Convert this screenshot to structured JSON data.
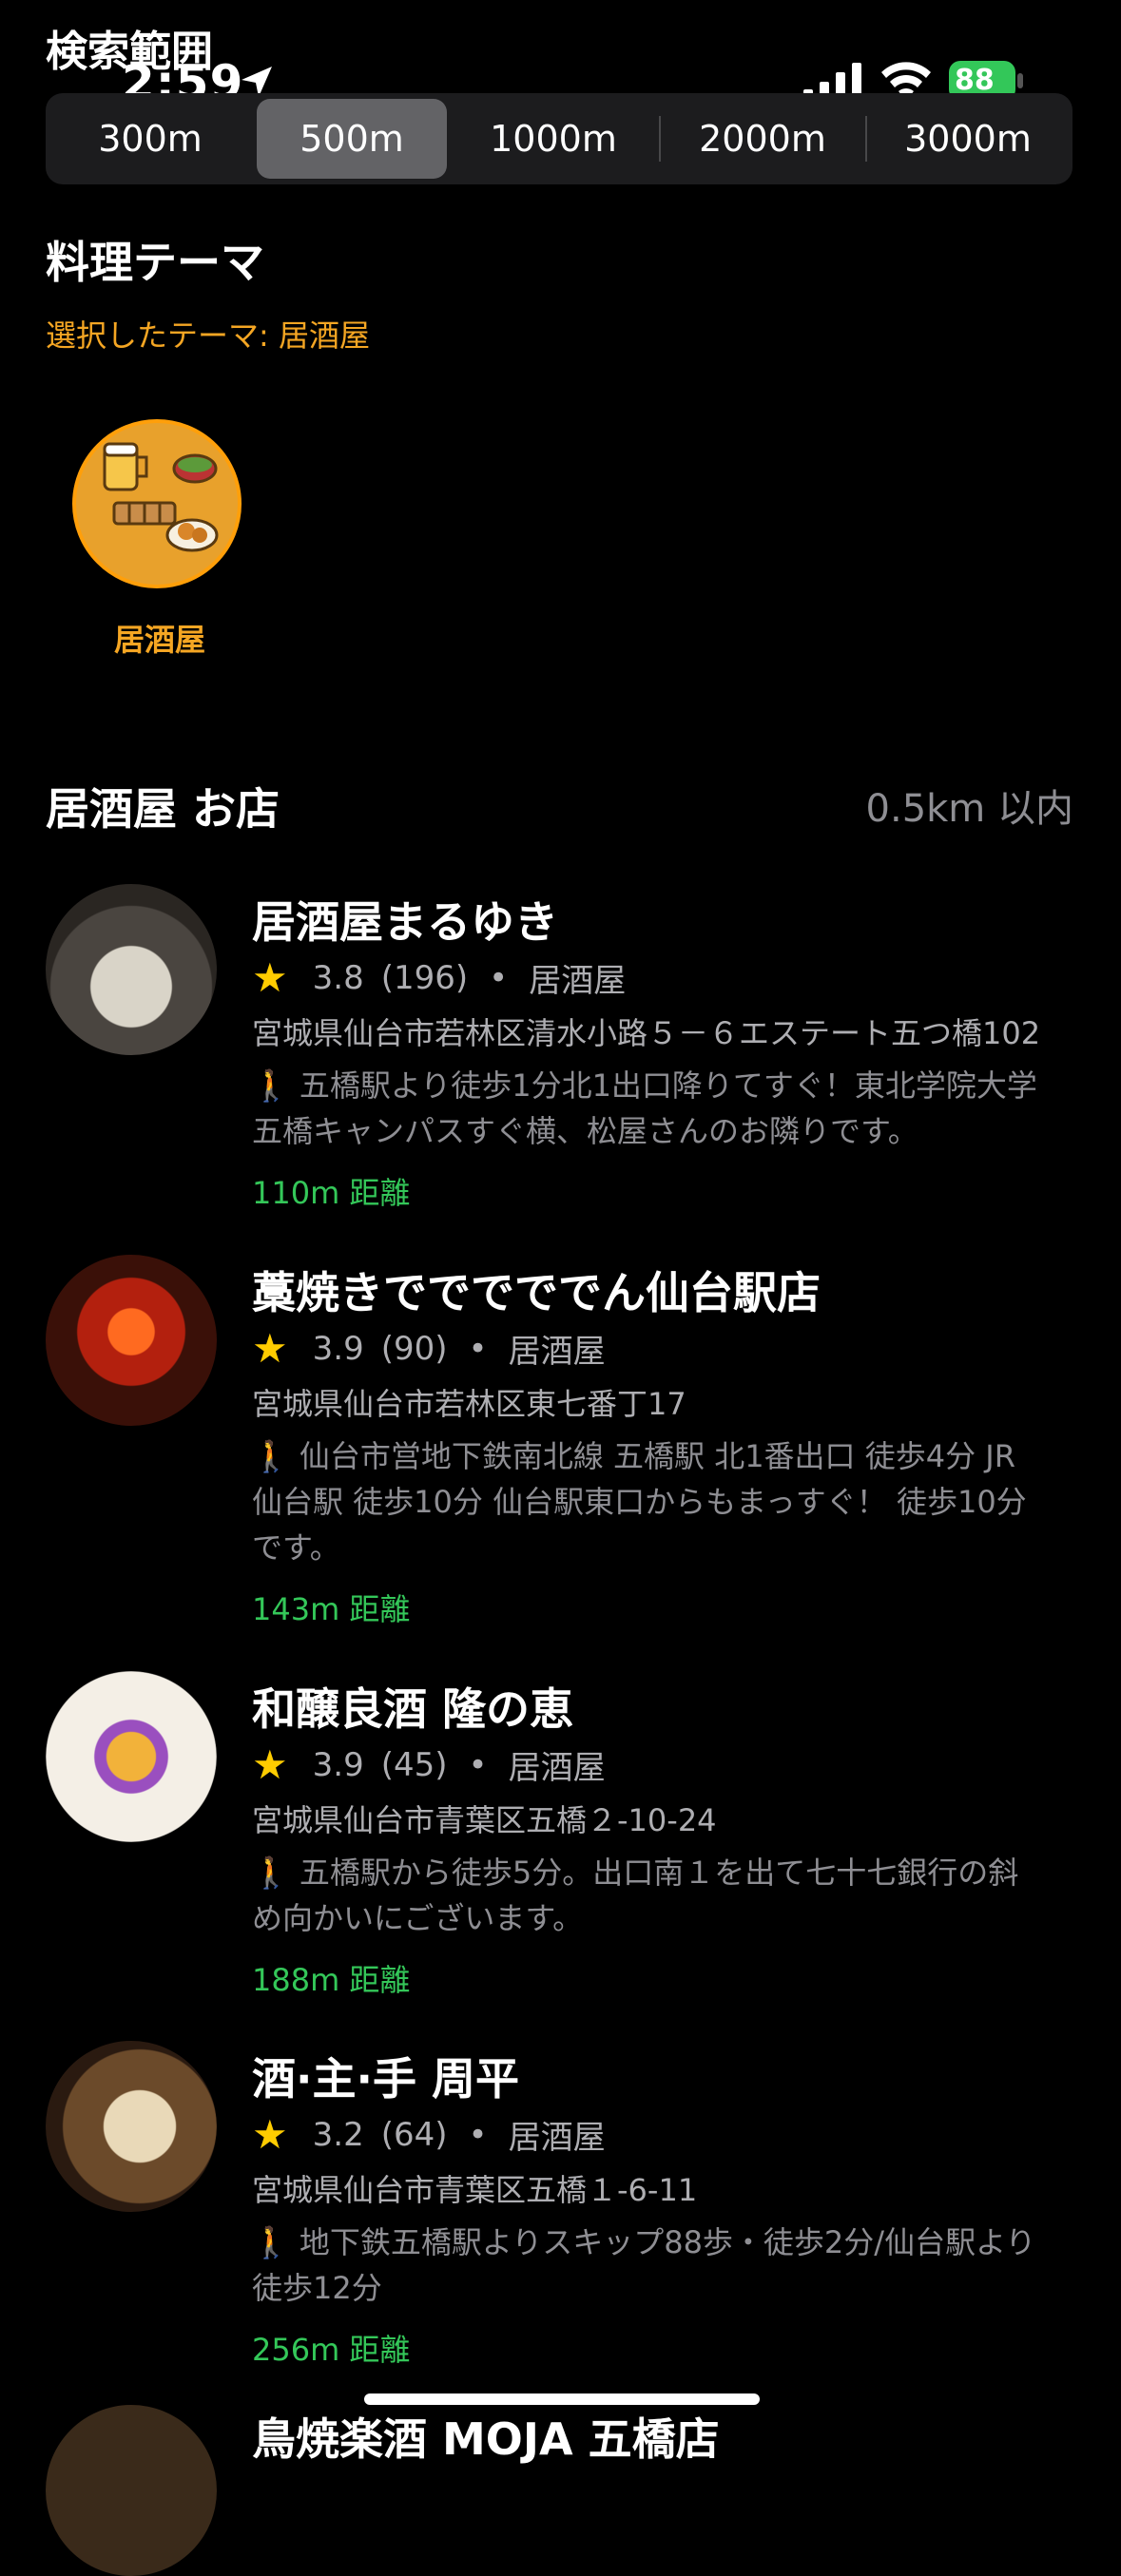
{
  "status": {
    "time": "2:59",
    "battery": "88"
  },
  "header": {
    "title": "検索範囲"
  },
  "segments": [
    "300m",
    "500m",
    "1000m",
    "2000m",
    "3000m"
  ],
  "selected_segment": "500m",
  "theme": {
    "section_title": "料理テーマ",
    "selected_text": "選択したテーマ: 居酒屋",
    "item_label": "居酒屋"
  },
  "shops_header": {
    "title": "居酒屋 お店",
    "radius": "0.5km 以内"
  },
  "shops": [
    {
      "name": "居酒屋まるゆき",
      "rating": "3.8",
      "reviews": "(196)",
      "category": "居酒屋",
      "address": "宮城県仙台市若林区清水小路５－６エステート五つ橋102",
      "access": "五橋駅より徒歩1分北1出口降りてすぐ！東北学院大学五橋キャンパスすぐ横、松屋さんのお隣りです。",
      "distance": "110m 距離"
    },
    {
      "name": "藁焼きでででででん仙台駅店",
      "rating": "3.9",
      "reviews": "(90)",
      "category": "居酒屋",
      "address": "宮城県仙台市若林区東七番丁17",
      "access": "仙台市営地下鉄南北線 五橋駅 北1番出口 徒歩4分 JR仙台駅 徒歩10分 仙台駅東口からもまっすぐ！ 徒歩10分です。",
      "distance": "143m 距離"
    },
    {
      "name": "和醸良酒 隆の恵",
      "rating": "3.9",
      "reviews": "(45)",
      "category": "居酒屋",
      "address": "宮城県仙台市青葉区五橋２-10-24",
      "access": "五橋駅から徒歩5分。出口南１を出て七十七銀行の斜め向かいにございます。",
      "distance": "188m 距離"
    },
    {
      "name": "酒·主·手 周平",
      "rating": "3.2",
      "reviews": "(64)",
      "category": "居酒屋",
      "address": "宮城県仙台市青葉区五橋１-6-11",
      "access": "地下鉄五橋駅よりスキップ88歩・徒歩2分/仙台駅より徒歩12分",
      "distance": "256m 距離"
    }
  ],
  "peek": {
    "name": "鳥焼楽酒 MOJA 五橋店"
  },
  "icons": {
    "star": "star-icon",
    "walk": "walking-person-icon",
    "location": "location-arrow-icon"
  }
}
